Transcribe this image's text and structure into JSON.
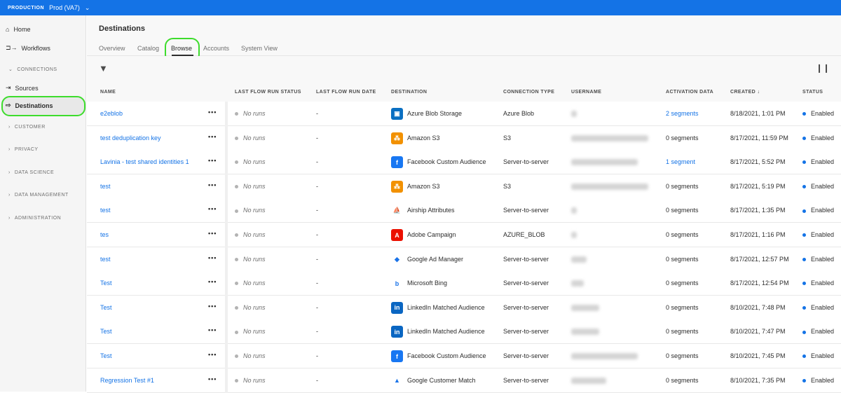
{
  "topbar": {
    "org": "PRODUCTION",
    "env": "Prod (VA7)"
  },
  "sidebar": {
    "home": "Home",
    "workflows": "Workflows",
    "connections": "CONNECTIONS",
    "sources": "Sources",
    "destinations": "Destinations",
    "customer": "CUSTOMER",
    "privacy": "PRIVACY",
    "data_science": "DATA SCIENCE",
    "data_management": "DATA MANAGEMENT",
    "administration": "ADMINISTRATION"
  },
  "header": {
    "title": "Destinations",
    "tabs": [
      "Overview",
      "Catalog",
      "Browse",
      "Accounts",
      "System View"
    ]
  },
  "columns": [
    "NAME",
    "LAST FLOW RUN STATUS",
    "LAST FLOW RUN DATE",
    "DESTINATION",
    "CONNECTION TYPE",
    "USERNAME",
    "ACTIVATION DATA",
    "CREATED ↓",
    "STATUS"
  ],
  "rows": [
    {
      "name": "e2eblob",
      "run_status": "No runs",
      "run_date": "-",
      "destination": "Azure Blob Storage",
      "icon": "azure-icon",
      "conn": "Azure Blob",
      "username_width": 8,
      "activation": "2 segments",
      "act_link": true,
      "created": "8/18/2021, 1:01 PM",
      "status": "Enabled"
    },
    {
      "name": "test deduplication key",
      "run_status": "No runs",
      "run_date": "-",
      "destination": "Amazon S3",
      "icon": "amazon-s3-icon",
      "conn": "S3",
      "username_width": 110,
      "activation": "0 segments",
      "act_link": false,
      "created": "8/17/2021, 11:59 PM",
      "status": "Enabled"
    },
    {
      "name": "Lavinia - test shared identities 1",
      "run_status": "No runs",
      "run_date": "-",
      "destination": "Facebook Custom Audience",
      "icon": "facebook-icon",
      "conn": "Server-to-server",
      "username_width": 95,
      "activation": "1 segment",
      "act_link": true,
      "created": "8/17/2021, 5:52 PM",
      "status": "Enabled"
    },
    {
      "name": "test",
      "run_status": "No runs",
      "run_date": "-",
      "destination": "Amazon S3",
      "icon": "amazon-s3-icon",
      "conn": "S3",
      "username_width": 110,
      "activation": "0 segments",
      "act_link": false,
      "created": "8/17/2021, 5:19 PM",
      "status": "Enabled"
    },
    {
      "name": "test",
      "run_status": "No runs",
      "run_date": "-",
      "destination": "Airship Attributes",
      "icon": "airship-icon",
      "conn": "Server-to-server",
      "username_width": 8,
      "activation": "0 segments",
      "act_link": false,
      "created": "8/17/2021, 1:35 PM",
      "status": "Enabled"
    },
    {
      "name": "tes",
      "run_status": "No runs",
      "run_date": "-",
      "destination": "Adobe Campaign",
      "icon": "adobe-icon",
      "conn": "AZURE_BLOB",
      "username_width": 8,
      "activation": "0 segments",
      "act_link": false,
      "created": "8/17/2021, 1:16 PM",
      "status": "Enabled"
    },
    {
      "name": "test",
      "run_status": "No runs",
      "run_date": "-",
      "destination": "Google Ad Manager",
      "icon": "google-ad-manager-icon",
      "conn": "Server-to-server",
      "username_width": 22,
      "activation": "0 segments",
      "act_link": false,
      "created": "8/17/2021, 12:57 PM",
      "status": "Enabled"
    },
    {
      "name": "Test",
      "run_status": "No runs",
      "run_date": "-",
      "destination": "Microsoft Bing",
      "icon": "bing-icon",
      "conn": "Server-to-server",
      "username_width": 18,
      "activation": "0 segments",
      "act_link": false,
      "created": "8/17/2021, 12:54 PM",
      "status": "Enabled"
    },
    {
      "name": "Test",
      "run_status": "No runs",
      "run_date": "-",
      "destination": "LinkedIn Matched Audience",
      "icon": "linkedin-icon",
      "conn": "Server-to-server",
      "username_width": 40,
      "activation": "0 segments",
      "act_link": false,
      "created": "8/10/2021, 7:48 PM",
      "status": "Enabled"
    },
    {
      "name": "Test",
      "run_status": "No runs",
      "run_date": "-",
      "destination": "LinkedIn Matched Audience",
      "icon": "linkedin-icon",
      "conn": "Server-to-server",
      "username_width": 40,
      "activation": "0 segments",
      "act_link": false,
      "created": "8/10/2021, 7:47 PM",
      "status": "Enabled"
    },
    {
      "name": "Test",
      "run_status": "No runs",
      "run_date": "-",
      "destination": "Facebook Custom Audience",
      "icon": "facebook-icon",
      "conn": "Server-to-server",
      "username_width": 95,
      "activation": "0 segments",
      "act_link": false,
      "created": "8/10/2021, 7:45 PM",
      "status": "Enabled"
    },
    {
      "name": "Regression Test #1",
      "run_status": "No runs",
      "run_date": "-",
      "destination": "Google Customer Match",
      "icon": "google-ads-icon",
      "conn": "Server-to-server",
      "username_width": 50,
      "activation": "0 segments",
      "act_link": false,
      "created": "8/10/2021, 7:35 PM",
      "status": "Enabled"
    }
  ],
  "colors": {
    "accent": "#1473e6",
    "highlight": "#3ddc2c"
  }
}
